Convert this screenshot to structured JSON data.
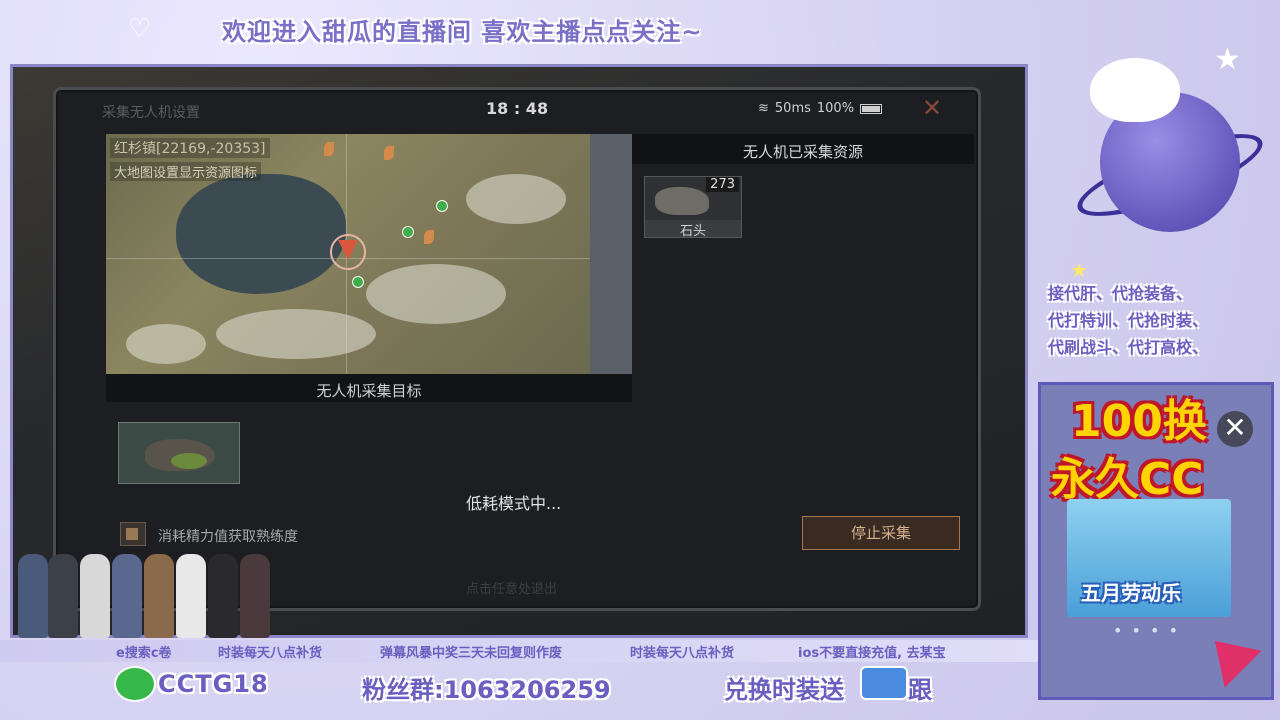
{
  "overlay": {
    "welcome_text": "欢迎进入甜瓜的直播间 喜欢主播点点关注~",
    "services": [
      "接代肝、代抢装备、",
      "代打特训、代抢时装、",
      "代刷战斗、代打高校、"
    ],
    "ad": {
      "line1": "100换",
      "line2": "永久CC",
      "poster_title": "五月劳动乐",
      "dots": "• • • •",
      "close_glyph": "✕"
    },
    "ticker": [
      "e搜索c卷",
      "时装每天八点补货",
      "弹幕风暴中奖三天未回复则作废",
      "时装每天八点补货",
      "ios不要直接充值, 去某宝"
    ],
    "bottom": {
      "wechat_id": "CCTG18",
      "fans_group": "粉丝群:1063206259",
      "exchange": "兑换时装送",
      "follow": "跟"
    }
  },
  "game": {
    "panel_title": "采集无人机设置",
    "time": "18 : 48",
    "ping": "50ms",
    "battery": "100%",
    "close_glyph": "✕",
    "map": {
      "coord_label": "红杉镇[22169,-20353]",
      "hint": "大地图设置显示资源图标"
    },
    "target_header": "无人机采集目标",
    "collected_header": "无人机已采集资源",
    "collected_items": [
      {
        "name": "石头",
        "count": "273"
      }
    ],
    "low_power_text": "低耗模式中...",
    "checkbox_label": "消耗精力值获取熟练度",
    "stop_button": "停止采集",
    "below_text": "点击任意处退出"
  },
  "colors": {
    "overlay_text": "#6a5fc0",
    "stop_button_border": "#a7774b",
    "marker": "#d9573f"
  }
}
